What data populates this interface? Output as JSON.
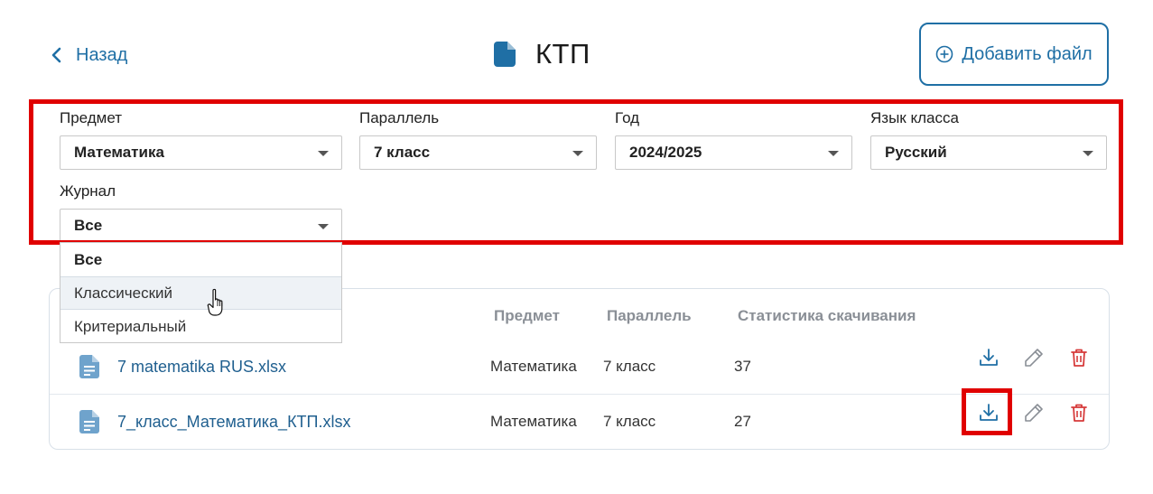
{
  "header": {
    "back_label": "Назад",
    "title": "КТП",
    "add_file_label": "Добавить файл"
  },
  "filters": {
    "subject": {
      "label": "Предмет",
      "value": "Математика"
    },
    "grade": {
      "label": "Параллель",
      "value": "7 класс"
    },
    "year": {
      "label": "Год",
      "value": "2024/2025"
    },
    "language": {
      "label": "Язык класса",
      "value": "Русский"
    },
    "journal": {
      "label": "Журнал",
      "value": "Все",
      "options": [
        "Все",
        "Классический",
        "Критериальный"
      ]
    }
  },
  "table": {
    "headers": [
      "Предмет",
      "Параллель",
      "Статистика скачивания"
    ],
    "rows": [
      {
        "file": "7 matematika RUS.xlsx",
        "subject": "Математика",
        "grade": "7 класс",
        "downloads": "37"
      },
      {
        "file": "7_класс_Математика_КТП.xlsx",
        "subject": "Математика",
        "grade": "7 класс",
        "downloads": "27"
      }
    ]
  },
  "colors": {
    "accent": "#1f6fa5",
    "highlight": "#e00000",
    "delete": "#d63a3a",
    "doc_icon": "#6fa3cc"
  },
  "icons": {
    "back": "chevron-left-icon",
    "title": "document-icon",
    "add": "plus-circle-icon",
    "file": "file-text-icon",
    "download": "download-icon",
    "edit": "pencil-icon",
    "delete": "trash-icon",
    "cursor": "hand-pointer-icon"
  }
}
